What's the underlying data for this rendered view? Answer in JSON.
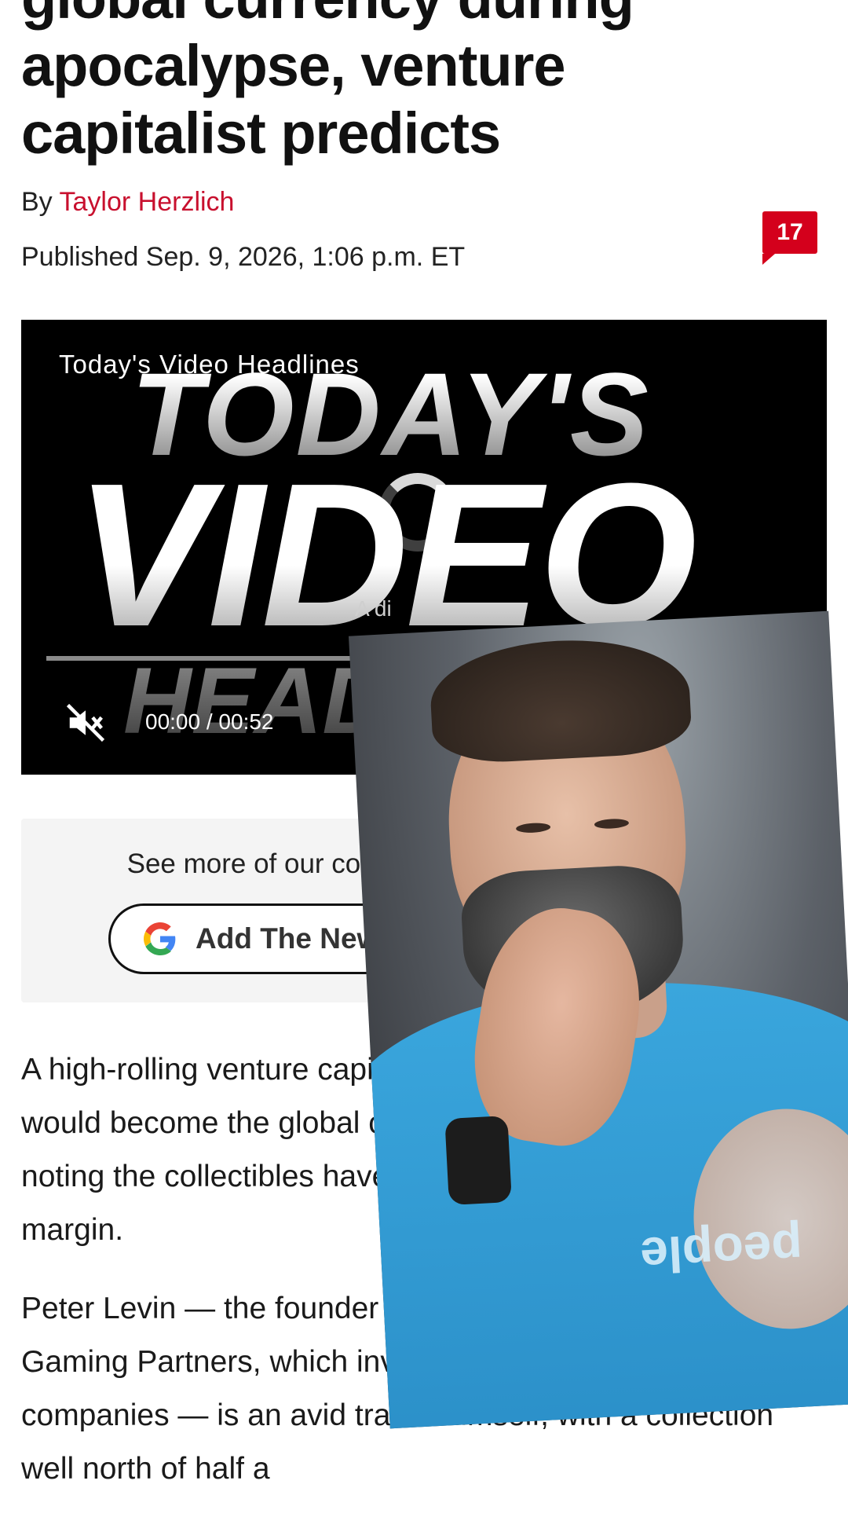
{
  "article": {
    "headline": "global currency during apocalypse, venture capitalist predicts",
    "by_prefix": "By ",
    "author": "Taylor Herzlich",
    "published": "Published Sep. 9, 2026, 1:06 p.m. ET",
    "comment_count": "17"
  },
  "video": {
    "label": "Today's Video Headlines",
    "title_line1": "TODAY'S",
    "title_line2": "VIDEO",
    "title_line3": "HEADLINES",
    "ad_text": "A  di",
    "current_time": "00:00",
    "separator": "/",
    "duration": "00:52",
    "muted": true
  },
  "promo": {
    "text": "See more of our coverage in your search results.",
    "button_label": "Add The New York Post on Google"
  },
  "body": {
    "paragraphs": [
      "A high-rolling venture capitalist predicts Pokémon cards would become the global currency during an apocalypse, noting the collectibles have beaten the S&P 500 by a wide margin.",
      "Peter Levin — the founder and managing partner of Griffin Gaming Partners, which invests in gaming and sports companies — is an avid trader himself, with a collection well north of half a"
    ]
  },
  "overlay": {
    "shirt_text": "people"
  },
  "colors": {
    "accent": "#c8102e",
    "badge": "#d4001c"
  }
}
